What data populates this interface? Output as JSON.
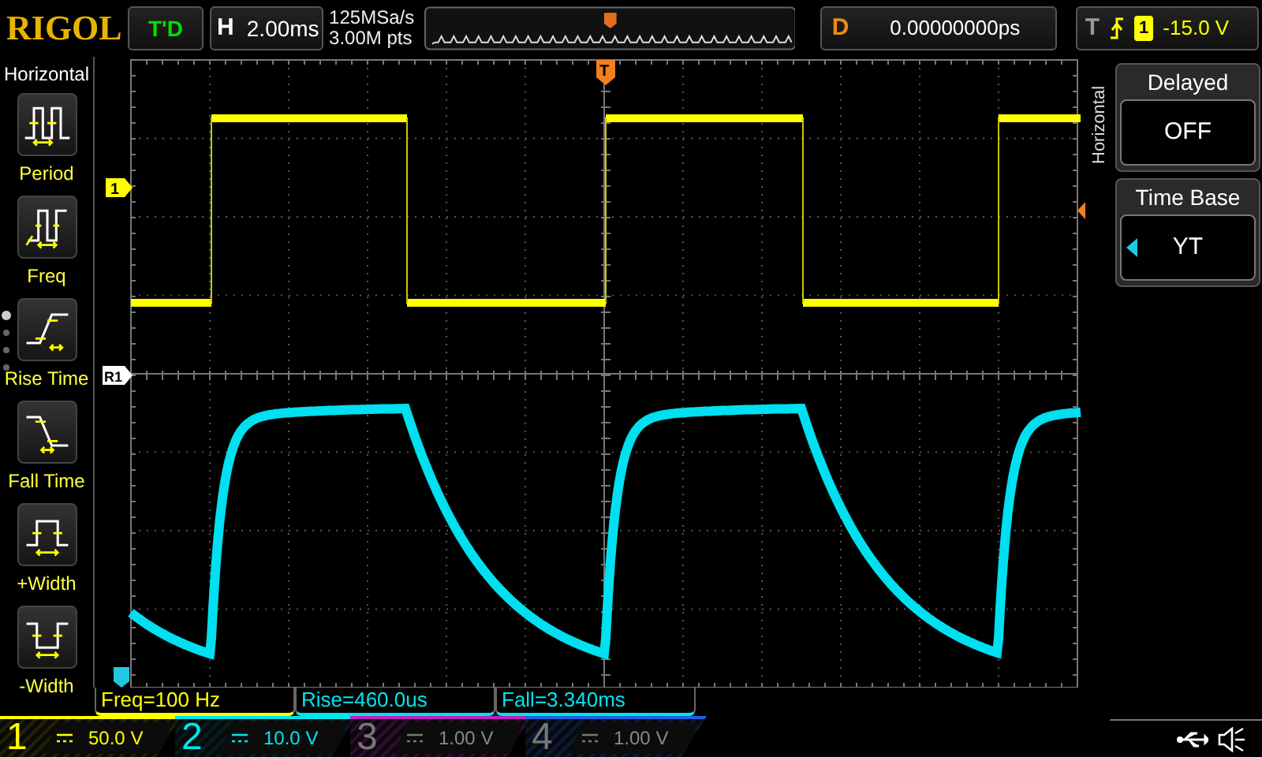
{
  "header": {
    "logo": "RIGOL",
    "run_status": "T'D",
    "timebase_label": "H",
    "timebase": "2.00ms",
    "sample_rate": "125MSa/s",
    "memory_depth": "3.00M pts",
    "delay_label": "D",
    "delay": "0.00000000ps",
    "trigger_label": "T",
    "trigger_source": "1",
    "trigger_level": "-15.0 V"
  },
  "menu": {
    "title": "Horizontal",
    "items": [
      {
        "label": "Period",
        "kind": "period"
      },
      {
        "label": "Freq",
        "kind": "freq"
      },
      {
        "label": "Rise Time",
        "kind": "rise"
      },
      {
        "label": "Fall Time",
        "kind": "fall"
      },
      {
        "label": "+Width",
        "kind": "pwidth"
      },
      {
        "label": "-Width",
        "kind": "nwidth"
      }
    ]
  },
  "markers": {
    "channel": "1",
    "reference": "R1",
    "trigger": "T"
  },
  "side_label": "Horizontal",
  "softkeys": [
    {
      "title": "Delayed",
      "value": "OFF",
      "cyclable": false
    },
    {
      "title": "Time Base",
      "value": "YT",
      "cyclable": true
    }
  ],
  "measurements": [
    {
      "text": "Freq=100 Hz",
      "color": "#ffff00"
    },
    {
      "text": "Rise=460.0us",
      "color": "#00e5ee"
    },
    {
      "text": "Fall=3.340ms",
      "color": "#00e5ee"
    }
  ],
  "channels": [
    {
      "number": "1",
      "scale": "50.0 V",
      "color": "#ffff00",
      "on": true
    },
    {
      "number": "2",
      "scale": "10.0 V",
      "color": "#00e5ee",
      "on": true
    },
    {
      "number": "3",
      "scale": "1.00 V",
      "color": "#c020c0",
      "on": false
    },
    {
      "number": "4",
      "scale": "1.00 V",
      "color": "#2060e0",
      "on": false
    }
  ]
}
